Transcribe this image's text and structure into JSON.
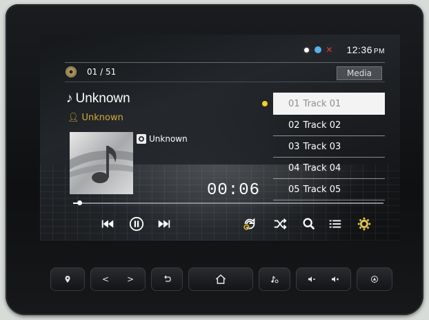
{
  "status_bar": {
    "icons": [
      "gps-icon",
      "bluetooth-icon",
      "phone-muted-icon"
    ],
    "time": "12:36",
    "ampm": "PM"
  },
  "player": {
    "track_counter": "01 / 51",
    "source_label": "Media",
    "title": "Unknown",
    "artist": "Unknown",
    "album": "Unknown",
    "elapsed": "00:06",
    "progress_fraction": 0.02
  },
  "tracklist": [
    {
      "num": "01",
      "name": "Track 01",
      "active": true
    },
    {
      "num": "02",
      "name": "Track 02",
      "active": false
    },
    {
      "num": "03",
      "name": "Track 03",
      "active": false
    },
    {
      "num": "04",
      "name": "Track 04",
      "active": false
    },
    {
      "num": "05",
      "name": "Track 05",
      "active": false
    }
  ],
  "controls": [
    "previous-icon",
    "pause-icon",
    "next-icon",
    "repeat-icon",
    "shuffle-icon",
    "search-icon",
    "list-icon",
    "settings-icon"
  ],
  "hardware_buttons": [
    "location-icon",
    "left-arrow-icon",
    "right-arrow-icon",
    "back-icon",
    "home-icon",
    "music-icon",
    "volume-down-icon",
    "volume-up-icon",
    "power-icon"
  ],
  "colors": {
    "accent_yellow": "#d4a93a",
    "active_dot": "#f2d21c",
    "active_row": "#f3f3f3"
  }
}
